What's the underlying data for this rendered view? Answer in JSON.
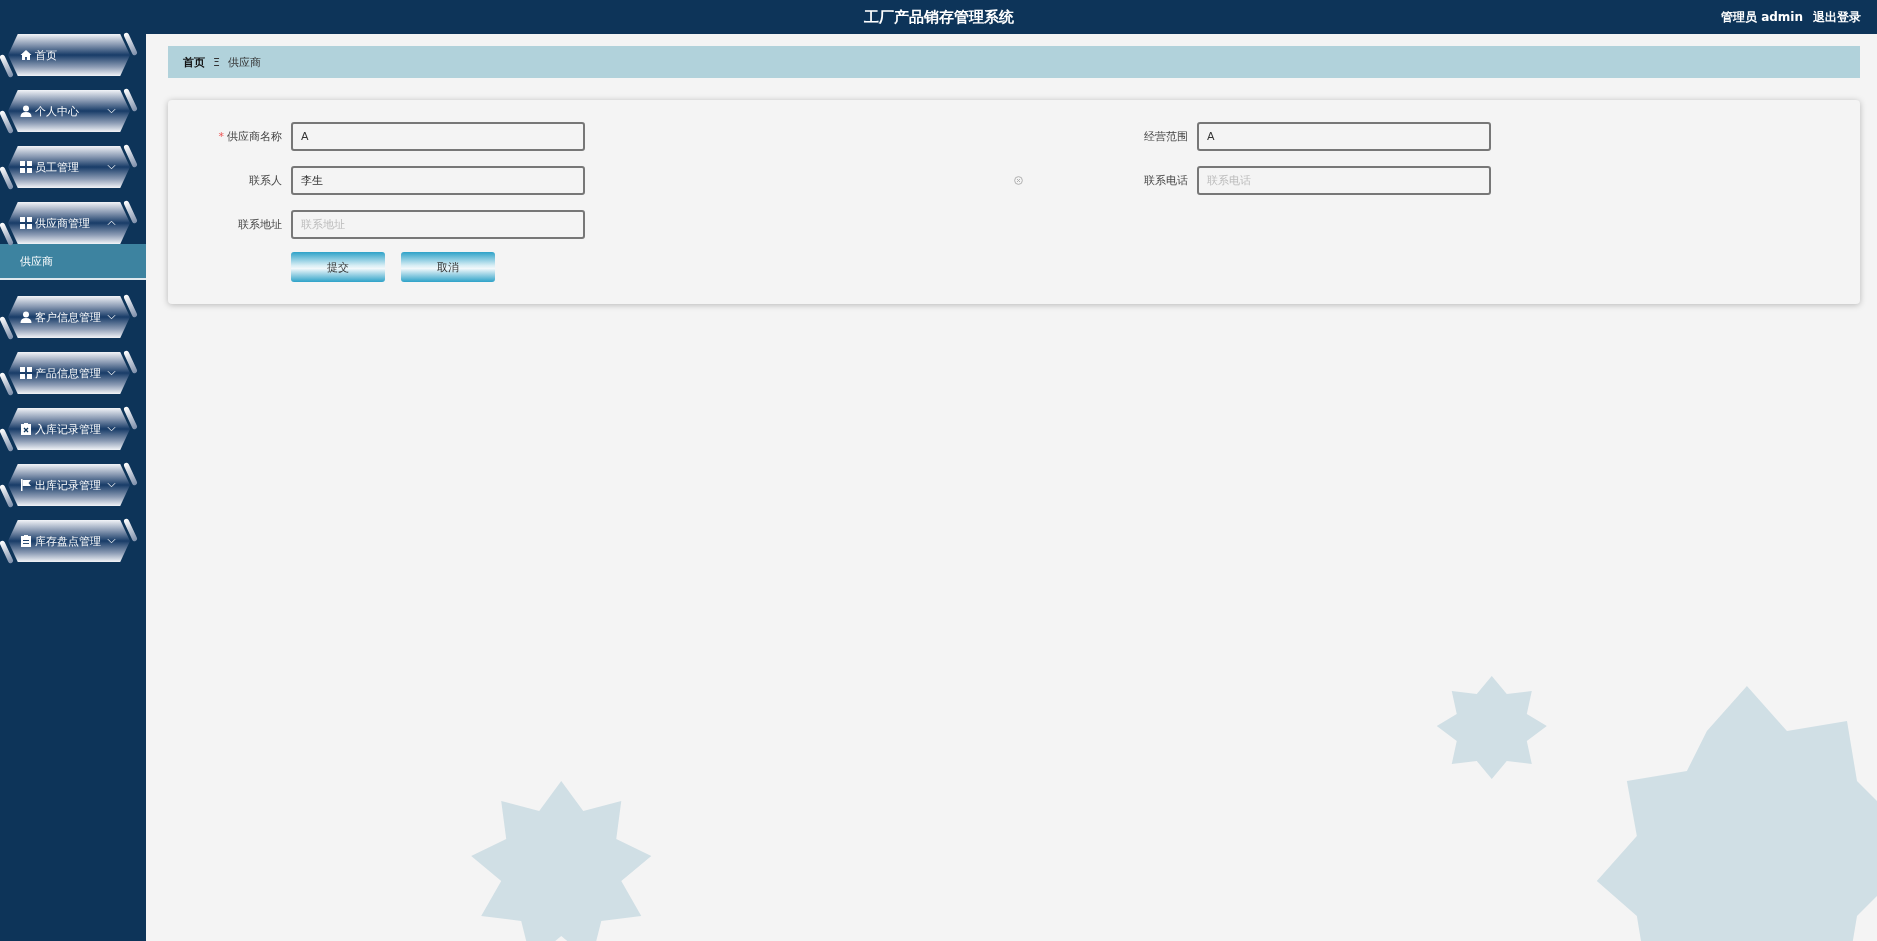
{
  "header": {
    "title": "工厂产品销存管理系统",
    "user": "管理员 admin",
    "logout": "退出登录"
  },
  "sidebar": {
    "items": [
      {
        "kind": "home",
        "label": "首页"
      },
      {
        "kind": "user",
        "label": "个人中心",
        "expanded": false
      },
      {
        "kind": "grid",
        "label": "员工管理",
        "expanded": false
      },
      {
        "kind": "grid",
        "label": "供应商管理",
        "expanded": true,
        "children": [
          {
            "label": "供应商",
            "selected": true
          }
        ]
      },
      {
        "kind": "user",
        "label": "客户信息管理",
        "expanded": false
      },
      {
        "kind": "grid",
        "label": "产品信息管理",
        "expanded": false
      },
      {
        "kind": "clipboard-x",
        "label": "入库记录管理",
        "expanded": false
      },
      {
        "kind": "flag",
        "label": "出库记录管理",
        "expanded": false
      },
      {
        "kind": "clipboard",
        "label": "库存盘点管理",
        "expanded": false
      }
    ]
  },
  "breadcrumb": {
    "home": "首页",
    "separator": "Ξ",
    "current": "供应商"
  },
  "form": {
    "fields": [
      {
        "label": "供应商名称",
        "required_mark": "*",
        "value": "A"
      },
      {
        "label": "经营范围",
        "value": "A"
      },
      {
        "label": "联系人",
        "value": "李生"
      },
      {
        "label": "联系电话",
        "placeholder": "联系电话",
        "clearable": true
      },
      {
        "label": "联系地址",
        "placeholder": "联系地址"
      }
    ],
    "buttons": [
      "提交",
      "取消"
    ]
  }
}
